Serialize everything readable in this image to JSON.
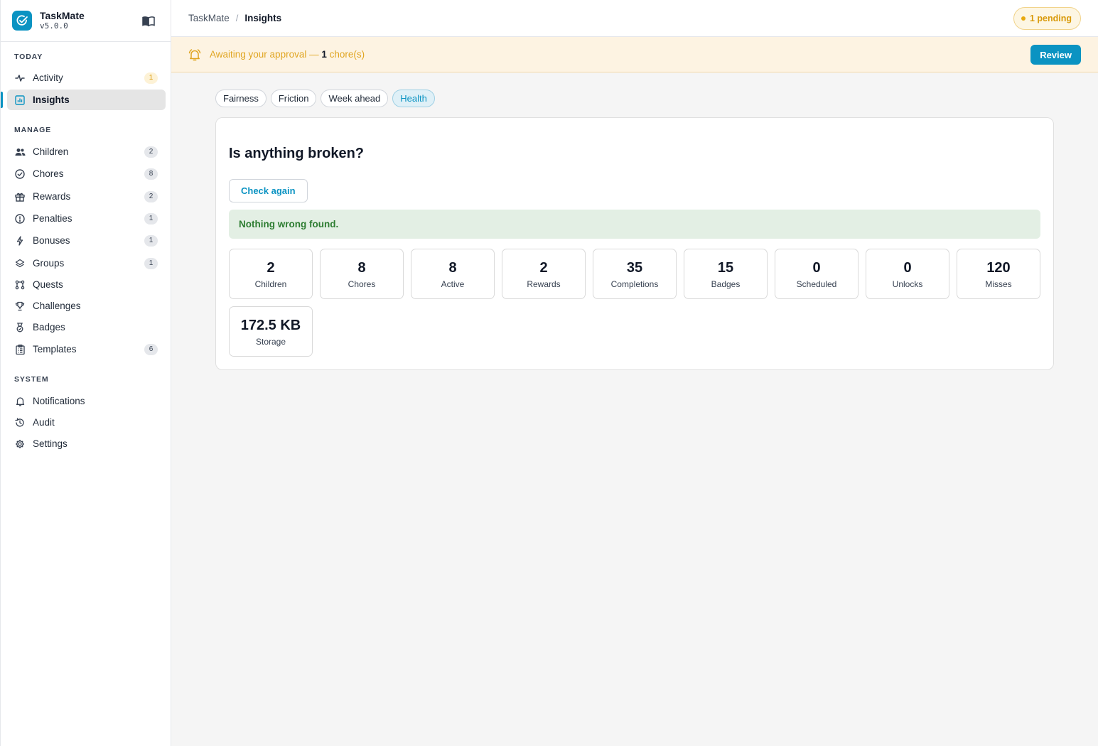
{
  "app": {
    "name": "TaskMate",
    "version": "v5.0.0"
  },
  "sidebar": {
    "sections": [
      {
        "label": "TODAY"
      },
      {
        "label": "MANAGE"
      },
      {
        "label": "SYSTEM"
      }
    ],
    "items": [
      {
        "label": "Activity",
        "icon": "activity-icon",
        "count": "1",
        "active": false
      },
      {
        "label": "Insights",
        "icon": "chart-icon",
        "active": true
      },
      {
        "label": "Children",
        "icon": "users-icon",
        "count": "2"
      },
      {
        "label": "Chores",
        "icon": "check-circle-icon",
        "count": "8"
      },
      {
        "label": "Rewards",
        "icon": "gift-icon",
        "count": "2"
      },
      {
        "label": "Penalties",
        "icon": "alert-circle-icon",
        "count": "1"
      },
      {
        "label": "Bonuses",
        "icon": "bolt-icon",
        "count": "1"
      },
      {
        "label": "Groups",
        "icon": "layers-icon",
        "count": "1"
      },
      {
        "label": "Quests",
        "icon": "route-icon"
      },
      {
        "label": "Challenges",
        "icon": "trophy-icon"
      },
      {
        "label": "Badges",
        "icon": "medal-icon"
      },
      {
        "label": "Templates",
        "icon": "clipboard-icon",
        "count": "6"
      },
      {
        "label": "Notifications",
        "icon": "bell-icon"
      },
      {
        "label": "Audit",
        "icon": "history-icon"
      },
      {
        "label": "Settings",
        "icon": "gear-icon"
      }
    ]
  },
  "breadcrumb": {
    "root": "TaskMate",
    "separator": "/",
    "current": "Insights"
  },
  "pending": {
    "label": "1 pending"
  },
  "banner": {
    "prefix": "Awaiting your approval — ",
    "count": "1",
    "suffix": " chore(s)",
    "button": "Review"
  },
  "tabs": [
    {
      "label": "Fairness",
      "active": false
    },
    {
      "label": "Friction",
      "active": false
    },
    {
      "label": "Week ahead",
      "active": false
    },
    {
      "label": "Health",
      "active": true
    }
  ],
  "health": {
    "title": "Is anything broken?",
    "check_button": "Check again",
    "status": "Nothing wrong found.",
    "stats": [
      {
        "value": "2",
        "label": "Children"
      },
      {
        "value": "8",
        "label": "Chores"
      },
      {
        "value": "8",
        "label": "Active"
      },
      {
        "value": "2",
        "label": "Rewards"
      },
      {
        "value": "35",
        "label": "Completions"
      },
      {
        "value": "15",
        "label": "Badges"
      },
      {
        "value": "0",
        "label": "Scheduled"
      },
      {
        "value": "0",
        "label": "Unlocks"
      },
      {
        "value": "120",
        "label": "Misses"
      },
      {
        "value": "172.5 KB",
        "label": "Storage"
      }
    ]
  },
  "colors": {
    "accent": "#0b93c2",
    "warning": "#e0a521",
    "success": "#2e7d32"
  }
}
